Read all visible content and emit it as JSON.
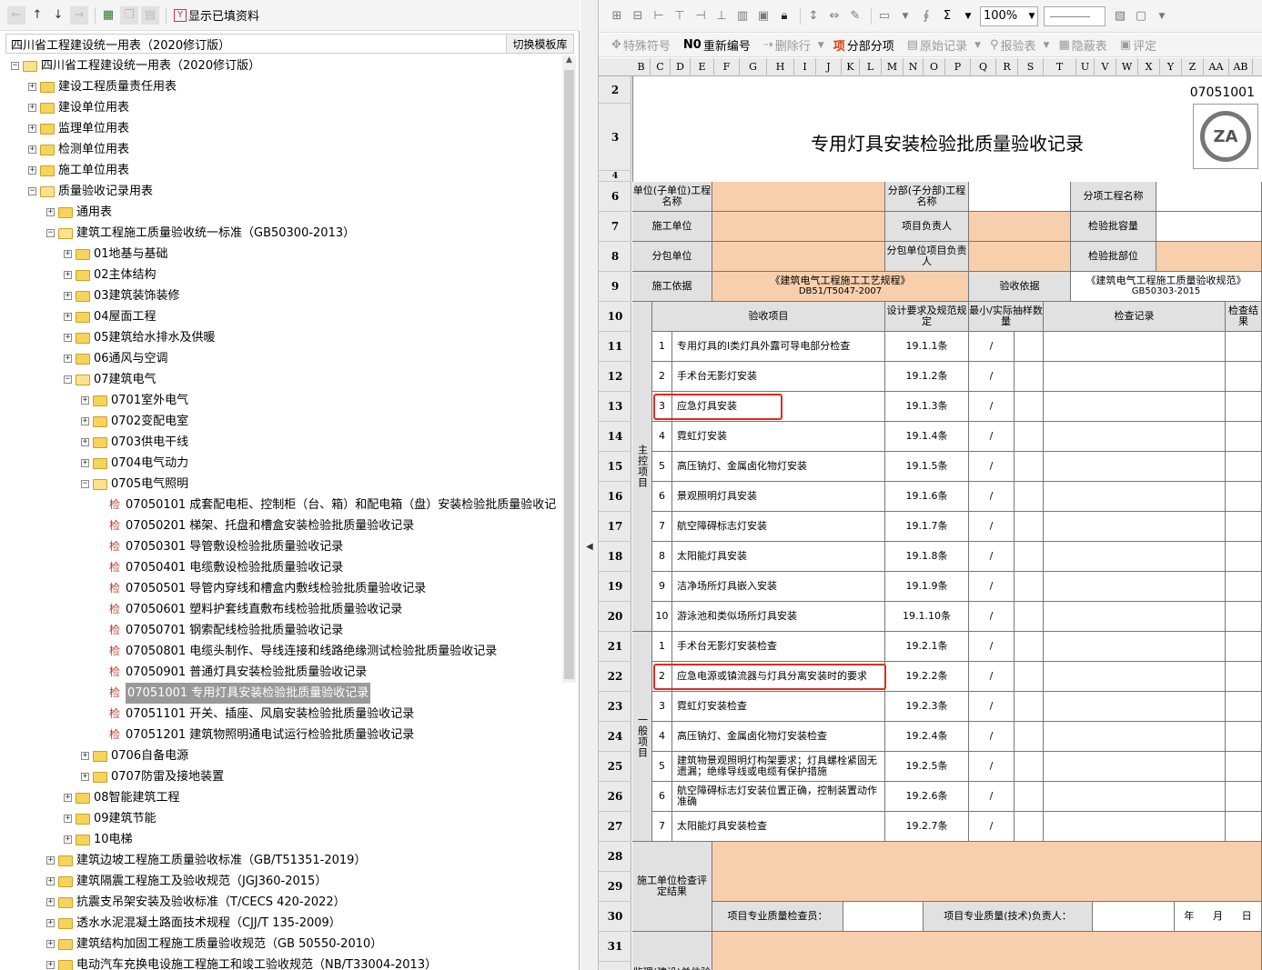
{
  "left_panel": {
    "toolbar": {
      "show_filled_label": "显示已填资料"
    },
    "header": {
      "title": "四川省工程建设统一用表（2020修订版）",
      "switch_button": "切换模板库"
    },
    "tree": [
      {
        "level": 0,
        "expander": "-",
        "type": "folder-open",
        "label": "四川省工程建设统一用表（2020修订版）"
      },
      {
        "level": 1,
        "expander": "+",
        "type": "folder",
        "label": "建设工程质量责任用表"
      },
      {
        "level": 1,
        "expander": "+",
        "type": "folder",
        "label": "建设单位用表"
      },
      {
        "level": 1,
        "expander": "+",
        "type": "folder",
        "label": "监理单位用表"
      },
      {
        "level": 1,
        "expander": "+",
        "type": "folder",
        "label": "检测单位用表"
      },
      {
        "level": 1,
        "expander": "+",
        "type": "folder",
        "label": "施工单位用表"
      },
      {
        "level": 1,
        "expander": "-",
        "type": "folder-open",
        "label": "质量验收记录用表"
      },
      {
        "level": 2,
        "expander": "+",
        "type": "folder",
        "label": "通用表"
      },
      {
        "level": 2,
        "expander": "-",
        "type": "folder-open",
        "label": "建筑工程施工质量验收统一标准（GB50300-2013）"
      },
      {
        "level": 3,
        "expander": "+",
        "type": "folder",
        "label": "01地基与基础"
      },
      {
        "level": 3,
        "expander": "+",
        "type": "folder",
        "label": "02主体结构"
      },
      {
        "level": 3,
        "expander": "+",
        "type": "folder",
        "label": "03建筑装饰装修"
      },
      {
        "level": 3,
        "expander": "+",
        "type": "folder",
        "label": "04屋面工程"
      },
      {
        "level": 3,
        "expander": "+",
        "type": "folder",
        "label": "05建筑给水排水及供暖"
      },
      {
        "level": 3,
        "expander": "+",
        "type": "folder",
        "label": "06通风与空调"
      },
      {
        "level": 3,
        "expander": "-",
        "type": "folder-open",
        "label": "07建筑电气"
      },
      {
        "level": 4,
        "expander": "+",
        "type": "folder",
        "label": "0701室外电气"
      },
      {
        "level": 4,
        "expander": "+",
        "type": "folder",
        "label": "0702变配电室"
      },
      {
        "level": 4,
        "expander": "+",
        "type": "folder",
        "label": "0703供电干线"
      },
      {
        "level": 4,
        "expander": "+",
        "type": "folder",
        "label": "0704电气动力"
      },
      {
        "level": 4,
        "expander": "-",
        "type": "folder-open",
        "label": "0705电气照明"
      },
      {
        "level": 5,
        "expander": "",
        "type": "form",
        "label": "07050101 成套配电柜、控制柜（台、箱）和配电箱（盘）安装检验批质量验收记"
      },
      {
        "level": 5,
        "expander": "",
        "type": "form",
        "label": "07050201 梯架、托盘和槽盒安装检验批质量验收记录"
      },
      {
        "level": 5,
        "expander": "",
        "type": "form",
        "label": "07050301 导管敷设检验批质量验收记录"
      },
      {
        "level": 5,
        "expander": "",
        "type": "form",
        "label": "07050401 电缆敷设检验批质量验收记录"
      },
      {
        "level": 5,
        "expander": "",
        "type": "form",
        "label": "07050501 导管内穿线和槽盒内敷线检验批质量验收记录"
      },
      {
        "level": 5,
        "expander": "",
        "type": "form",
        "label": "07050601 塑料护套线直敷布线检验批质量验收记录"
      },
      {
        "level": 5,
        "expander": "",
        "type": "form",
        "label": "07050701 钢索配线检验批质量验收记录"
      },
      {
        "level": 5,
        "expander": "",
        "type": "form",
        "label": "07050801 电缆头制作、导线连接和线路绝缘测试检验批质量验收记录"
      },
      {
        "level": 5,
        "expander": "",
        "type": "form",
        "label": "07050901 普通灯具安装检验批质量验收记录"
      },
      {
        "level": 5,
        "expander": "",
        "type": "form",
        "label": "07051001 专用灯具安装检验批质量验收记录",
        "selected": true
      },
      {
        "level": 5,
        "expander": "",
        "type": "form",
        "label": "07051101 开关、插座、风扇安装检验批质量验收记录"
      },
      {
        "level": 5,
        "expander": "",
        "type": "form",
        "label": "07051201 建筑物照明通电试运行检验批质量验收记录"
      },
      {
        "level": 4,
        "expander": "+",
        "type": "folder",
        "label": "0706自备电源"
      },
      {
        "level": 4,
        "expander": "+",
        "type": "folder",
        "label": "0707防雷及接地装置"
      },
      {
        "level": 3,
        "expander": "+",
        "type": "folder",
        "label": "08智能建筑工程"
      },
      {
        "level": 3,
        "expander": "+",
        "type": "folder",
        "label": "09建筑节能"
      },
      {
        "level": 3,
        "expander": "+",
        "type": "folder",
        "label": "10电梯"
      },
      {
        "level": 2,
        "expander": "+",
        "type": "folder",
        "label": "建筑边坡工程施工质量验收标准（GB/T51351-2019）"
      },
      {
        "level": 2,
        "expander": "+",
        "type": "folder",
        "label": "建筑隔震工程施工及验收规范（JGJ360-2015）"
      },
      {
        "level": 2,
        "expander": "+",
        "type": "folder",
        "label": "抗震支吊架安装及验收标准（T/CECS 420-2022）"
      },
      {
        "level": 2,
        "expander": "+",
        "type": "folder",
        "label": "透水水泥混凝土路面技术规程（CJJ/T 135-2009）"
      },
      {
        "level": 2,
        "expander": "+",
        "type": "folder",
        "label": "建筑结构加固工程施工质量验收规范（GB 50550-2010）"
      },
      {
        "level": 2,
        "expander": "+",
        "type": "folder",
        "label": "电动汽车充换电设施工程施工和竣工验收规范（NB/T33004-2013）"
      }
    ],
    "form_marker": "检"
  },
  "right_panel": {
    "toolbar1": {
      "sum_symbol": "Σ",
      "zoom": "100%"
    },
    "toolbar2": [
      {
        "key": "",
        "label": "特殊符号",
        "enabled": false
      },
      {
        "key": "N0",
        "label": "重新编号",
        "enabled": true
      },
      {
        "key": "",
        "label": "删除行",
        "enabled": false
      },
      {
        "key": "项",
        "label": "分部分项",
        "enabled": true,
        "red": true
      },
      {
        "key": "",
        "label": "原始记录",
        "enabled": false
      },
      {
        "key": "",
        "label": "报验表",
        "enabled": false
      },
      {
        "key": "",
        "label": "隐蔽表",
        "enabled": false
      },
      {
        "key": "",
        "label": "评定",
        "enabled": false
      }
    ],
    "columns": [
      "B",
      "C",
      "D",
      "E",
      "F",
      "G",
      "H",
      "I",
      "J",
      "K",
      "L",
      "M",
      "N",
      "O",
      "P",
      "Q",
      "R",
      "S",
      "T",
      "U",
      "V",
      "W",
      "X",
      "Y",
      "Z",
      "AA",
      "AB"
    ],
    "rows": [
      "2",
      "3",
      "4",
      "6",
      "7",
      "8",
      "9",
      "10",
      "11",
      "12",
      "13",
      "14",
      "15",
      "16",
      "17",
      "18",
      "19",
      "20",
      "21",
      "22",
      "23",
      "24",
      "25",
      "26",
      "27",
      "28",
      "29",
      "30",
      "31",
      "32"
    ],
    "form": {
      "code": "07051001",
      "title": "专用灯具安装检验批质量验收记录",
      "logo_text": "ZA",
      "header": {
        "unit_project_label": "单位(子单位)工程名称",
        "sub_project_label": "分部(子分部)工程名称",
        "item_project_label": "分项工程名称",
        "contractor_label": "施工单位",
        "project_manager_label": "项目负责人",
        "batch_capacity_label": "检验批容量",
        "subcontractor_label": "分包单位",
        "sub_manager_label": "分包单位项目负责人",
        "batch_location_label": "检验批部位",
        "construction_basis_label": "施工依据",
        "construction_basis_value": "《建筑电气工程施工工艺规程》",
        "construction_basis_code": "DB51/T5047-2007",
        "acceptance_basis_label": "验收依据",
        "acceptance_basis_value": "《建筑电气工程施工质量验收规范》",
        "acceptance_basis_code": "GB50303-2015"
      },
      "table_header": {
        "item": "验收项目",
        "design": "设计要求及规范规定",
        "sample": "最小/实际抽样数量",
        "record": "检查记录",
        "result": "检查结果"
      },
      "main_label": "主控项目",
      "general_label": "一般项目",
      "main_items": [
        {
          "no": "1",
          "text": "专用灯具的Ⅰ类灯具外露可导电部分检查",
          "clause": "19.1.1条"
        },
        {
          "no": "2",
          "text": "手术台无影灯安装",
          "clause": "19.1.2条"
        },
        {
          "no": "3",
          "text": "应急灯具安装",
          "clause": "19.1.3条",
          "highlight": true
        },
        {
          "no": "4",
          "text": "霓虹灯安装",
          "clause": "19.1.4条"
        },
        {
          "no": "5",
          "text": "高压钠灯、金属卤化物灯安装",
          "clause": "19.1.5条"
        },
        {
          "no": "6",
          "text": "景观照明灯具安装",
          "clause": "19.1.6条"
        },
        {
          "no": "7",
          "text": "航空障碍标志灯安装",
          "clause": "19.1.7条"
        },
        {
          "no": "8",
          "text": "太阳能灯具安装",
          "clause": "19.1.8条"
        },
        {
          "no": "9",
          "text": "洁净场所灯具嵌入安装",
          "clause": "19.1.9条"
        },
        {
          "no": "10",
          "text": "游泳池和类似场所灯具安装",
          "clause": "19.1.10条"
        }
      ],
      "general_items": [
        {
          "no": "1",
          "text": "手术台无影灯安装检查",
          "clause": "19.2.1条"
        },
        {
          "no": "2",
          "text": "应急电源或镇流器与灯具分离安装时的要求",
          "clause": "19.2.2条",
          "highlight": true
        },
        {
          "no": "3",
          "text": "霓虹灯安装检查",
          "clause": "19.2.3条"
        },
        {
          "no": "4",
          "text": "高压钠灯、金属卤化物灯安装检查",
          "clause": "19.2.4条"
        },
        {
          "no": "5",
          "text": "建筑物景观照明灯构架要求；灯具螺栓紧固无遗漏；绝缘导线或电缆有保护措施",
          "clause": "19.2.5条"
        },
        {
          "no": "6",
          "text": "航空障碍标志灯安装位置正确，控制装置动作准确",
          "clause": "19.2.6条"
        },
        {
          "no": "7",
          "text": "太阳能灯具安装检查",
          "clause": "19.2.7条"
        }
      ],
      "sample_slash": "/",
      "footer": {
        "contractor_result_label": "施工单位检查评定结果",
        "inspector_label": "项目专业质量检查员：",
        "tech_manager_label": "项目专业质量(技术)负责人：",
        "year": "年",
        "month": "月",
        "day": "日",
        "supervisor_label": "监理(建设)单位验收结论"
      }
    }
  },
  "colors": {
    "orange_cell": "#f8cfac",
    "highlight_box": "#e32a1e",
    "selected_row": "#999999"
  }
}
